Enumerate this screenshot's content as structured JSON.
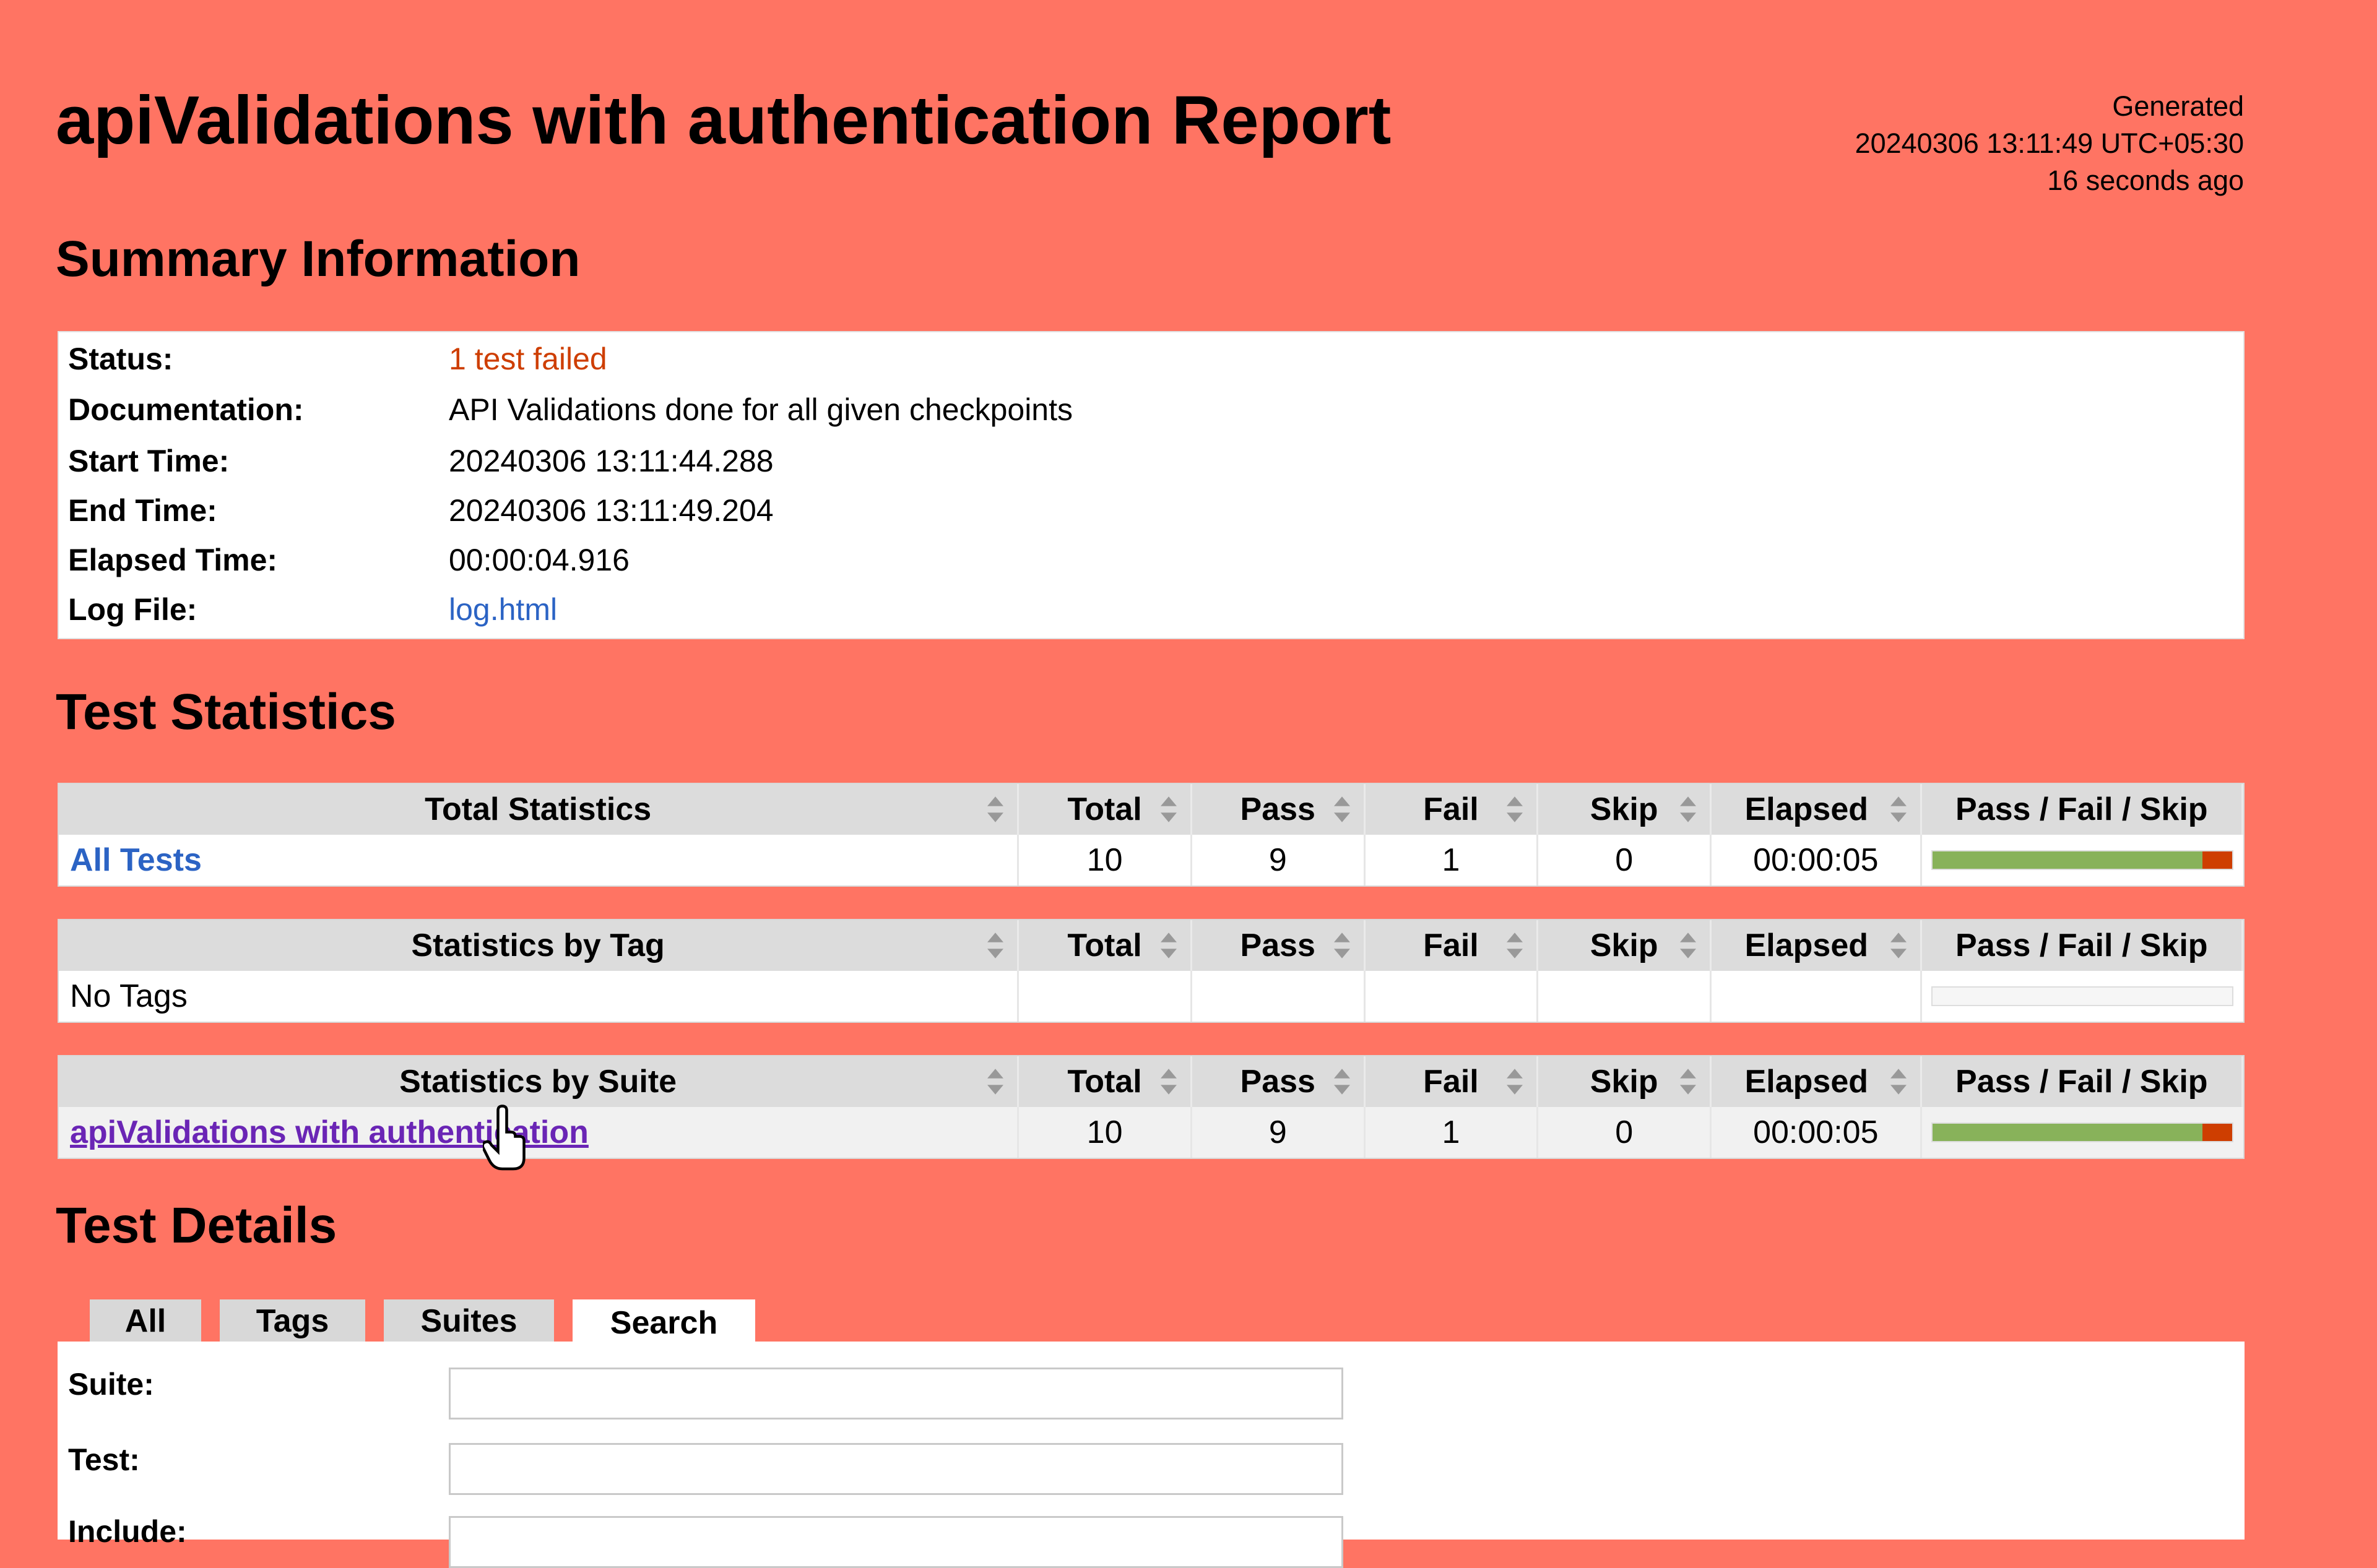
{
  "report": {
    "title": "apiValidations with authentication Report",
    "generated": {
      "label": "Generated",
      "timestamp": "20240306 13:11:49 UTC+05:30",
      "ago": "16 seconds ago"
    }
  },
  "summary": {
    "heading": "Summary Information",
    "rows": [
      {
        "label": "Status:",
        "value": "1 test failed"
      },
      {
        "label": "Documentation:",
        "value": "API Validations done for all given checkpoints"
      },
      {
        "label": "Start Time:",
        "value": "20240306 13:11:44.288"
      },
      {
        "label": "End Time:",
        "value": "20240306 13:11:49.204"
      },
      {
        "label": "Elapsed Time:",
        "value": "00:00:04.916"
      },
      {
        "label": "Log File:",
        "value": "log.html"
      }
    ]
  },
  "statistics": {
    "heading": "Test Statistics",
    "columns": [
      "Total",
      "Pass",
      "Fail",
      "Skip",
      "Elapsed",
      "Pass / Fail / Skip"
    ],
    "total": {
      "header": "Total Statistics",
      "row": {
        "name": "All Tests",
        "total": "10",
        "pass": "9",
        "fail": "1",
        "skip": "0",
        "elapsed": "00:00:05",
        "pass_fraction": 0.9,
        "fail_fraction": 0.1
      }
    },
    "by_tag": {
      "header": "Statistics by Tag",
      "row": {
        "name": "No Tags"
      }
    },
    "by_suite": {
      "header": "Statistics by Suite",
      "row": {
        "name": "apiValidations with authentication",
        "total": "10",
        "pass": "9",
        "fail": "1",
        "skip": "0",
        "elapsed": "00:00:05",
        "pass_fraction": 0.9,
        "fail_fraction": 0.1
      }
    }
  },
  "details": {
    "heading": "Test Details",
    "tabs": [
      "All",
      "Tags",
      "Suites",
      "Search"
    ],
    "active_tab": "Search",
    "fields": [
      {
        "label": "Suite:",
        "value": ""
      },
      {
        "label": "Test:",
        "value": ""
      },
      {
        "label": "Include:",
        "value": ""
      }
    ]
  },
  "colors": {
    "background": "#ff7463",
    "pass": "#88b25a",
    "fail": "#ce3e01",
    "link": "#2b63c4"
  }
}
